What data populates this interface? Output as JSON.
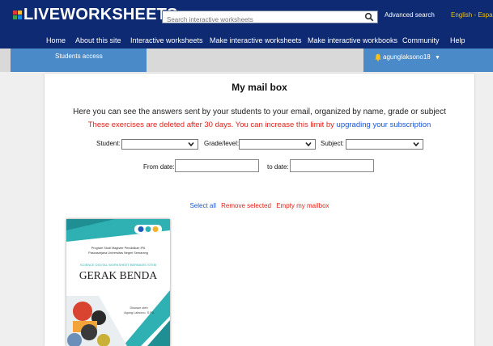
{
  "header": {
    "logo_text": "LIVEWORKSHEETS",
    "search_placeholder": "Search interactive worksheets",
    "advanced_search": "Advanced search",
    "language": "English - Español"
  },
  "nav": [
    "Home",
    "About this site",
    "Interactive worksheets",
    "Make interactive worksheets",
    "Make interactive workbooks",
    "Community",
    "Help"
  ],
  "subbar": {
    "students_access": "Students access",
    "username": "agunglaksono18"
  },
  "mailbox": {
    "title": "My mail box",
    "intro": "Here you can see the answers sent by your students to your email, organized by name, grade or subject",
    "notice": "These exercises are deleted after 30 days. You can increase this limit by",
    "notice_link": "upgrading your subscription",
    "filters": {
      "student_label": "Student:",
      "student_value": "",
      "grade_label": "Grade/level:",
      "grade_value": "",
      "subject_label": "Subject:",
      "subject_value": "",
      "from_date_label": "From date:",
      "from_date_value": "",
      "to_date_label": "to date:",
      "to_date_value": ""
    },
    "actions": {
      "select_all": "Select all",
      "remove_selected": "Remove selected",
      "empty_mailbox": "Empty my mailbox"
    }
  },
  "worksheet": {
    "program_line1": "Program Studi Magister Pendidikan IPA",
    "program_line2": "Pascasarjana Universitas Negeri Semarang",
    "series": "SCIENCE DIGITAL WORKSHEET BERBASIS STEM",
    "title": "GERAK BENDA",
    "author_line1": "Disusun oleh:",
    "author_line2": "Agung Laksono, S.Pd."
  },
  "colors": {
    "header_bg": "#0e2a73",
    "accent_blue": "#4a8ac9",
    "notice_red": "#e0221b",
    "link_blue": "#1a56d6",
    "language_yellow": "#f3c300"
  }
}
